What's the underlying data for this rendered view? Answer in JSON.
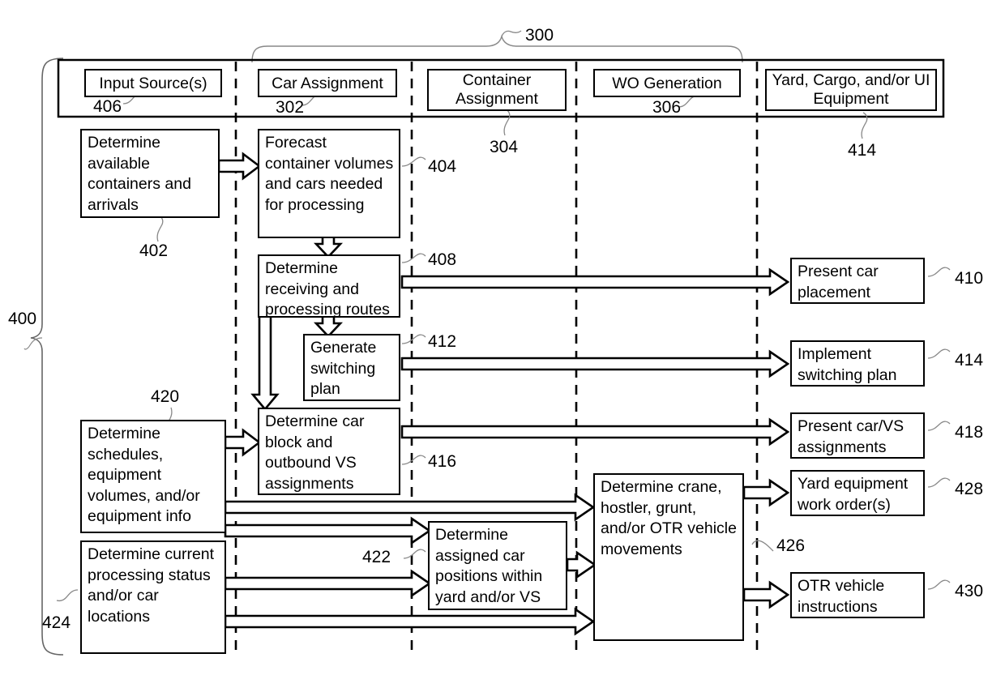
{
  "figure": {
    "overall_ref": "400",
    "system_ref": "300"
  },
  "lanes": [
    {
      "title": "Input Source(s)",
      "ref": "406"
    },
    {
      "title": "Car Assignment",
      "ref": "302"
    },
    {
      "title": "Container Assignment",
      "ref": "304"
    },
    {
      "title": "WO Generation",
      "ref": "306"
    },
    {
      "title": "Yard, Cargo, and/or UI Equipment",
      "ref": "414"
    }
  ],
  "nodes": {
    "n402": {
      "text": "Determine available containers and arrivals",
      "ref": "402"
    },
    "n404": {
      "text": "Forecast container volumes and cars needed for processing",
      "ref": "404"
    },
    "n408": {
      "text": "Determine receiving and processing routes",
      "ref": "408"
    },
    "n412": {
      "text": "Generate switching plan",
      "ref": "412"
    },
    "n416": {
      "text": "Determine car block and outbound VS assignments",
      "ref": "416"
    },
    "n420": {
      "text": "Determine schedules, equipment volumes, and/or equipment info",
      "ref": "420"
    },
    "n424": {
      "text": "Determine current processing status and/or car locations",
      "ref": "424"
    },
    "n422": {
      "text": "Determine assigned car positions within yard and/or VS",
      "ref": "422"
    },
    "n426": {
      "text": "Determine crane, hostler, grunt, and/or OTR vehicle movements",
      "ref": "426"
    },
    "n410": {
      "text": "Present car placement",
      "ref": "410"
    },
    "n414": {
      "text": "Implement switching plan",
      "ref": "414"
    },
    "n418": {
      "text": "Present car/VS assignments",
      "ref": "418"
    },
    "n428": {
      "text": "Yard equipment work order(s)",
      "ref": "428"
    },
    "n430": {
      "text": "OTR vehicle instructions",
      "ref": "430"
    }
  },
  "colors": {
    "stroke": "#000000",
    "background": "#ffffff",
    "leader": "#777777"
  }
}
